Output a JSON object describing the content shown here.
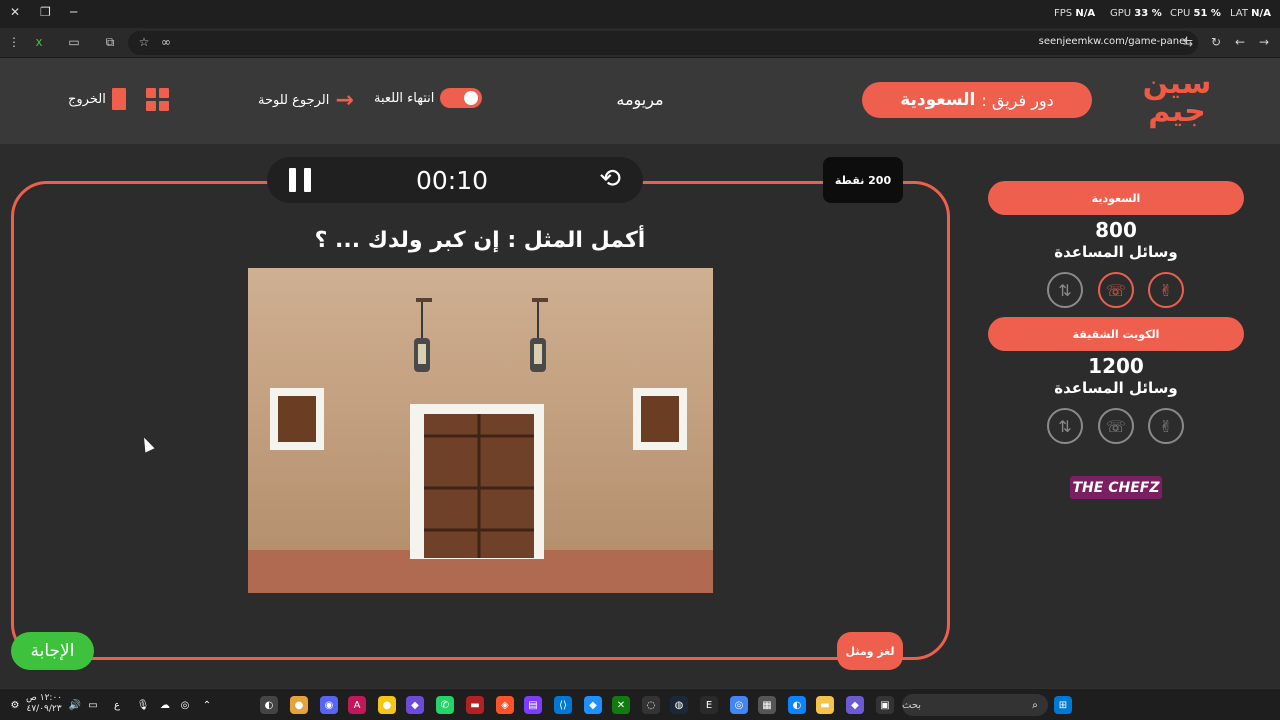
{
  "browser": {
    "url": "seenjeemkw.com/game-panel",
    "perf": {
      "fps_label": "FPS",
      "fps_value": "N/A",
      "gpu_label": "GPU",
      "gpu_value": "33 %",
      "cpu_label": "CPU",
      "cpu_value": "51 %",
      "lat_label": "LAT",
      "lat_value": "N/A"
    }
  },
  "header": {
    "logo_text": "سين جيم",
    "turn_prefix": "دور فريق :",
    "turn_team": "السعودية",
    "game_name": "مريومه",
    "end_game_label": "انتهاء اللعبة",
    "back_to_board_label": "الرجوع للوحة",
    "exit_label": "الخروج"
  },
  "question_panel": {
    "timer": "00:10",
    "points_label": "200 نقطة",
    "question": "أكمل المثل : إن كبر ولدك ... ؟",
    "category_label": "لغز ومثل",
    "answer_button": "الإجابة"
  },
  "teams": [
    {
      "name": "السعودية",
      "score": "800",
      "helpers_label": "وسائل المساعدة",
      "helpers": [
        "two-fingers-icon",
        "phone-icon",
        "swap-icon"
      ],
      "active": true
    },
    {
      "name": "الكويت الشقيقة",
      "score": "1200",
      "helpers_label": "وسائل المساعدة",
      "helpers": [
        "two-fingers-icon",
        "phone-icon",
        "swap-icon"
      ],
      "active": false
    }
  ],
  "sponsor": "THE CHEFZ",
  "taskbar": {
    "search_placeholder": "بحث",
    "time": "١٢:٠٠ ص",
    "date": "٤٧/٠٩/٢٣",
    "lang": "ع"
  },
  "colors": {
    "accent": "#ee5f4e",
    "answer_green": "#3ec23e",
    "background": "#2c2c2c",
    "header": "#393939"
  }
}
